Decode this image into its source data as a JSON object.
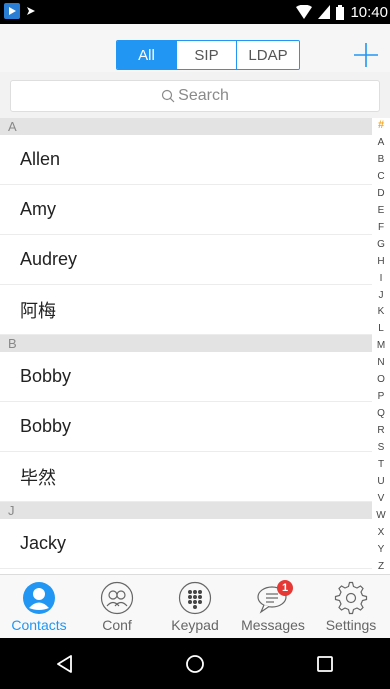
{
  "status_bar": {
    "time": "10:40"
  },
  "header": {
    "segments": [
      {
        "label": "All",
        "active": true
      },
      {
        "label": "SIP",
        "active": false
      },
      {
        "label": "LDAP",
        "active": false
      }
    ],
    "add_icon": "plus-icon"
  },
  "search": {
    "placeholder": "Search"
  },
  "sections": [
    {
      "letter": "A",
      "contacts": [
        "Allen",
        "Amy",
        "Audrey",
        "阿梅"
      ]
    },
    {
      "letter": "B",
      "contacts": [
        "Bobby",
        "Bobby",
        "毕然"
      ]
    },
    {
      "letter": "J",
      "contacts": [
        "Jacky"
      ]
    }
  ],
  "alpha_index": [
    "#",
    "A",
    "B",
    "C",
    "D",
    "E",
    "F",
    "G",
    "H",
    "I",
    "J",
    "K",
    "L",
    "M",
    "N",
    "O",
    "P",
    "Q",
    "R",
    "S",
    "T",
    "U",
    "V",
    "W",
    "X",
    "Y",
    "Z"
  ],
  "tabs": [
    {
      "label": "Contacts",
      "icon": "contact-icon",
      "active": true
    },
    {
      "label": "Conf",
      "icon": "conference-icon",
      "active": false
    },
    {
      "label": "Keypad",
      "icon": "keypad-icon",
      "active": false
    },
    {
      "label": "Messages",
      "icon": "message-icon",
      "active": false,
      "badge": "1"
    },
    {
      "label": "Settings",
      "icon": "gear-icon",
      "active": false
    }
  ],
  "colors": {
    "accent": "#2196f3",
    "index_highlight": "#f5a623",
    "badge": "#e53935"
  }
}
